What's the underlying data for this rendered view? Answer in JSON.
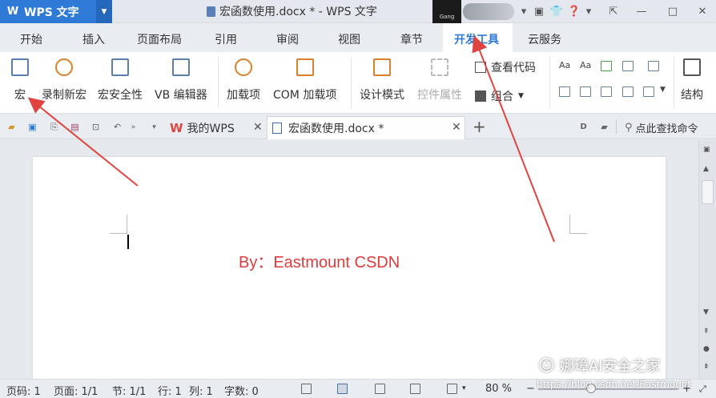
{
  "titlebar": {
    "app_name": "WPS 文字",
    "app_logo": "W",
    "doc_title": "宏函数使用.docx * - WPS 文字",
    "avatar_text": "Gang"
  },
  "menu_tabs": [
    "开始",
    "插入",
    "页面布局",
    "引用",
    "审阅",
    "视图",
    "章节",
    "开发工具",
    "云服务"
  ],
  "active_tab": "开发工具",
  "ribbon": {
    "macro": "宏",
    "record_macro": "录制新宏",
    "macro_security": "宏安全性",
    "vb_editor": "VB 编辑器",
    "addins": "加载项",
    "com_addins": "COM 加载项",
    "design_mode": "设计模式",
    "control_props": "控件属性",
    "view_code": "查看代码",
    "group": "组合",
    "structure": "结构"
  },
  "doc_tabs": {
    "mywps": "我的WPS",
    "current_doc": "宏函数使用.docx *",
    "search_cmd": "点此查找命令"
  },
  "document": {
    "byline": "By：Eastmount CSDN"
  },
  "statusbar": {
    "page_no": "页码: 1",
    "page": "页面: 1/1",
    "section": "节: 1/1",
    "line": "行: 1",
    "column": "列: 1",
    "word_count": "字数: 0",
    "zoom": "80 %",
    "zoom_minus": "−",
    "zoom_plus": "+"
  },
  "watermark": {
    "text": "娜璋AI安全之家",
    "url": "https://blog.csdn.net/Eastmount"
  },
  "colors": {
    "accent": "#2e7ad6",
    "byline": "#e03b3b",
    "arrow": "#e0443f"
  }
}
